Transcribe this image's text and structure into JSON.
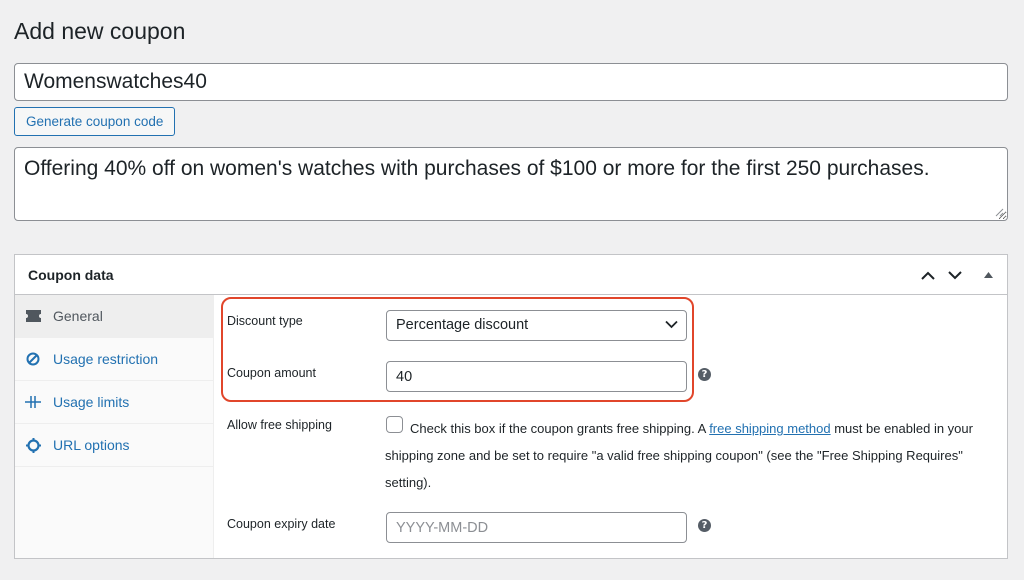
{
  "page": {
    "title": "Add new coupon"
  },
  "coupon": {
    "code": "Womenswatches40",
    "generate_label": "Generate coupon code",
    "description": "Offering 40% off on women's watches with purchases of $100 or more for the first 250 purchases."
  },
  "panel": {
    "title": "Coupon data",
    "tabs": [
      {
        "label": "General",
        "icon": "ticket-icon"
      },
      {
        "label": "Usage restriction",
        "icon": "prohibited-icon"
      },
      {
        "label": "Usage limits",
        "icon": "limits-icon"
      },
      {
        "label": "URL options",
        "icon": "gear-icon"
      }
    ],
    "fields": {
      "discount_type_label": "Discount type",
      "discount_type_value": "Percentage discount",
      "coupon_amount_label": "Coupon amount",
      "coupon_amount_value": "40",
      "free_shipping_label": "Allow free shipping",
      "free_shipping_text_before": "Check this box if the coupon grants free shipping. A ",
      "free_shipping_link": "free shipping method",
      "free_shipping_text_after": " must be enabled in your shipping zone and be set to require \"a valid free shipping coupon\" (see the \"Free Shipping Requires\" setting).",
      "expiry_label": "Coupon expiry date",
      "expiry_placeholder": "YYYY-MM-DD"
    }
  },
  "colors": {
    "accent": "#2271b1",
    "highlight": "#e1462b"
  }
}
